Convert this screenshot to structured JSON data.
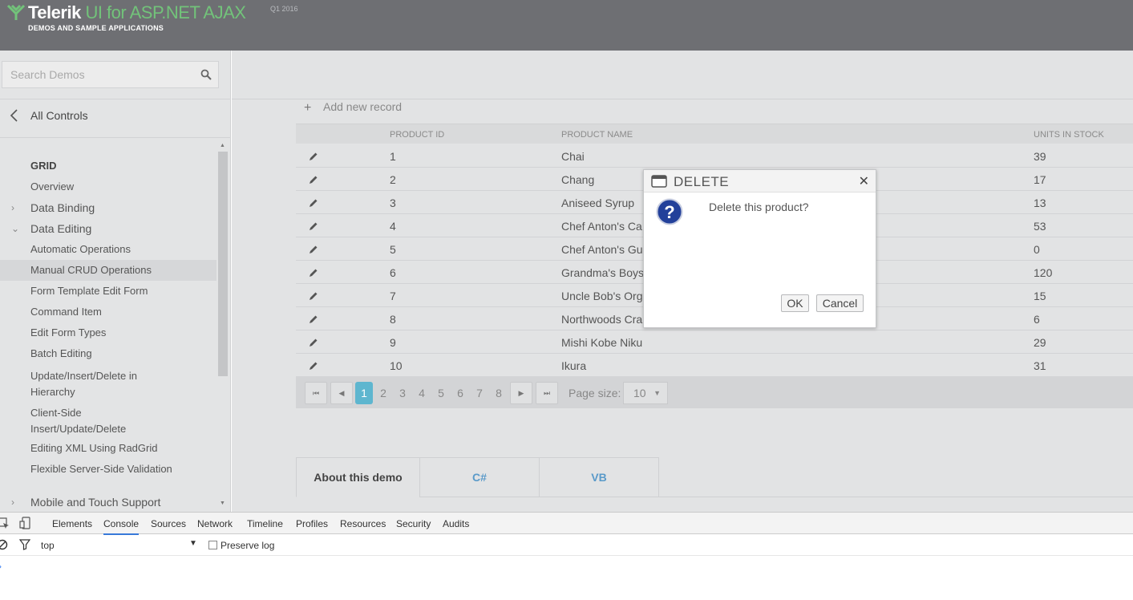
{
  "header": {
    "brand": "Telerik",
    "product": "UI for ASP.NET AJAX",
    "version": "Q1 2016",
    "subtitle": "DEMOS AND SAMPLE APPLICATIONS"
  },
  "sidebar": {
    "search_placeholder": "Search Demos",
    "all_controls": "All Controls",
    "group_title": "GRID",
    "items": [
      {
        "label": "Overview"
      },
      {
        "label": "Data Binding"
      },
      {
        "label": "Data Editing"
      },
      {
        "label": "Automatic Operations"
      },
      {
        "label": "Manual CRUD Operations"
      },
      {
        "label": "Form Template Edit Form"
      },
      {
        "label": "Command Item"
      },
      {
        "label": "Edit Form Types"
      },
      {
        "label": "Batch Editing"
      },
      {
        "label": "Update/Insert/Delete in",
        "label2": "Hierarchy"
      },
      {
        "label": "Client-Side",
        "label2": "Insert/Update/Delete"
      },
      {
        "label": "Editing XML Using RadGrid"
      },
      {
        "label": "Flexible Server-Side Validation"
      },
      {
        "label": "Mobile and Touch Support"
      }
    ]
  },
  "grid": {
    "add_new_record": "Add new record",
    "columns": [
      "PRODUCT ID",
      "PRODUCT NAME",
      "UNITS IN STOCK"
    ],
    "rows": [
      {
        "id": "1",
        "name": "Chai",
        "units": "39"
      },
      {
        "id": "2",
        "name": "Chang",
        "units": "17"
      },
      {
        "id": "3",
        "name": "Aniseed Syrup",
        "units": "13"
      },
      {
        "id": "4",
        "name": "Chef Anton's Ca",
        "units": "53"
      },
      {
        "id": "5",
        "name": "Chef Anton's Gu",
        "units": "0"
      },
      {
        "id": "6",
        "name": "Grandma's Boys",
        "units": "120"
      },
      {
        "id": "7",
        "name": "Uncle Bob's Org",
        "units": "15"
      },
      {
        "id": "8",
        "name": "Northwoods Cra",
        "units": "6"
      },
      {
        "id": "9",
        "name": "Mishi Kobe Niku",
        "units": "29"
      },
      {
        "id": "10",
        "name": "Ikura",
        "units": "31"
      }
    ],
    "pager": {
      "pages": [
        "1",
        "2",
        "3",
        "4",
        "5",
        "6",
        "7",
        "8"
      ],
      "current": "1",
      "page_size_label": "Page size:",
      "page_size": "10"
    }
  },
  "demo_tabs": [
    "About this demo",
    "C#",
    "VB"
  ],
  "dialog": {
    "title": "DELETE",
    "message": "Delete this product?",
    "ok": "OK",
    "cancel": "Cancel"
  },
  "devtools": {
    "tabs": [
      "Elements",
      "Console",
      "Sources",
      "Network",
      "Timeline",
      "Profiles",
      "Resources",
      "Security",
      "Audits"
    ],
    "active_tab": "Console",
    "context": "top",
    "preserve_log": "Preserve log",
    "prompt": "›"
  },
  "colors": {
    "header_bg": "#6e6f73",
    "brand_green": "#72c37a",
    "pager_current": "#5eb6cf",
    "devtools_accent": "#3879d9"
  }
}
